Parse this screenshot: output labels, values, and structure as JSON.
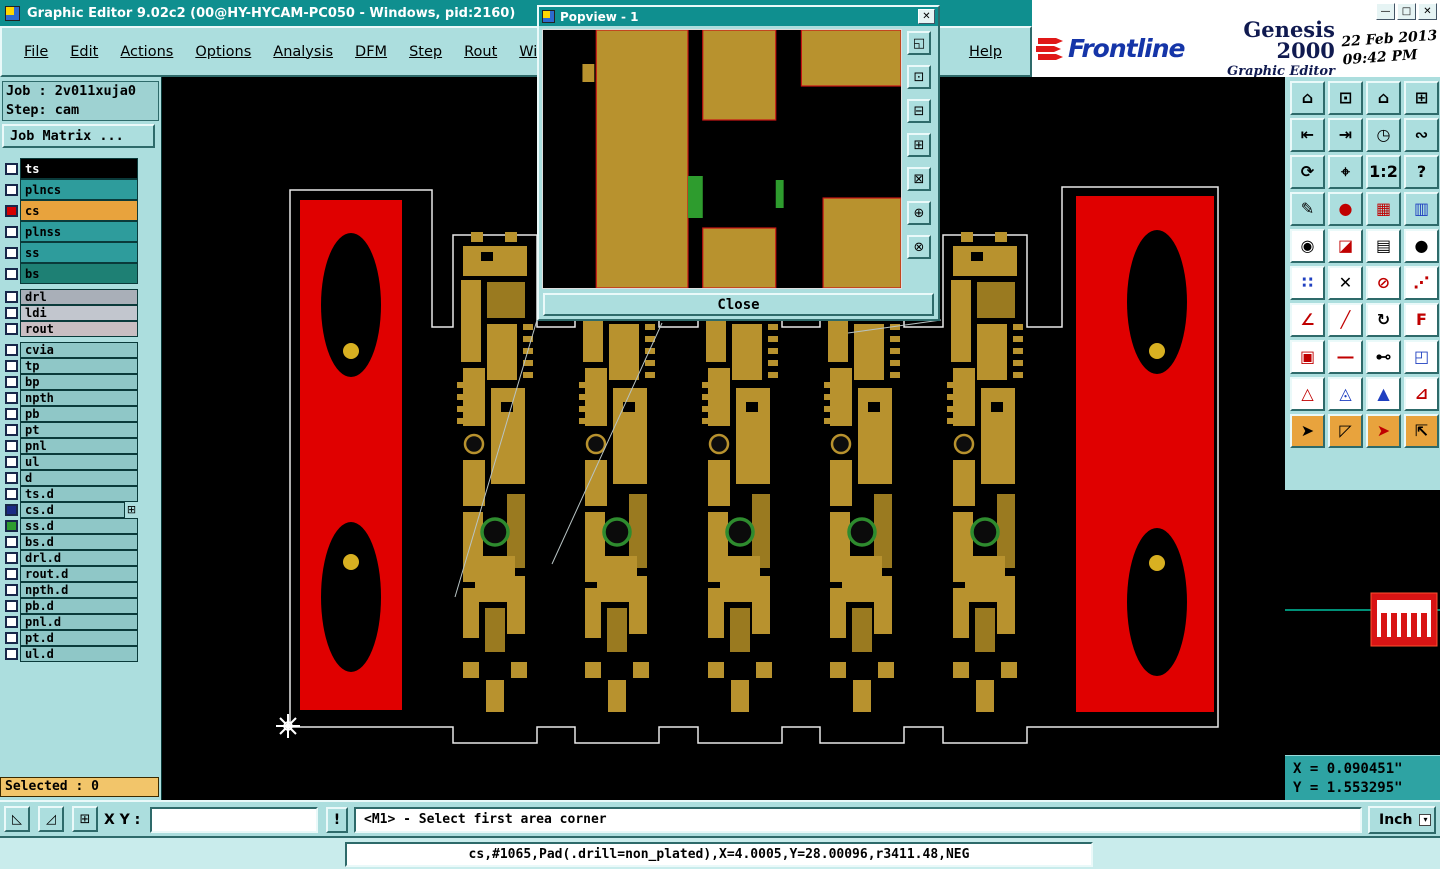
{
  "window": {
    "title": "Graphic Editor 9.02c2 (00@HY-HYCAM-PC050 - Windows, pid:2160)",
    "minimize": "—",
    "maximize": "□",
    "close": "✕"
  },
  "menu": {
    "items": [
      "File",
      "Edit",
      "Actions",
      "Options",
      "Analysis",
      "DFM",
      "Step",
      "Rout",
      "Windows"
    ],
    "help": "Help"
  },
  "brand": {
    "name": "Frontline",
    "product": "Genesis 2000",
    "subtitle": "Graphic Editor",
    "date": "22 Feb 2013",
    "time": "09:42 PM"
  },
  "job_panel": {
    "job": "Job : 2v011xuja0",
    "step": "Step: cam",
    "matrix_button": "Job Matrix ...",
    "selected": "Selected : 0"
  },
  "layers": [
    {
      "name": "ts",
      "color": "#000000",
      "text": "#FFFFFF",
      "check": "#FFFFFF"
    },
    {
      "name": "plncs",
      "color": "#2E9C9C",
      "text": "#000000",
      "check": "#FFFFFF"
    },
    {
      "name": "cs",
      "color": "#E8A33D",
      "text": "#000000",
      "check": "#D40000"
    },
    {
      "name": "plnss",
      "color": "#2E9C9C",
      "text": "#000000",
      "check": "#FFFFFF"
    },
    {
      "name": "ss",
      "color": "#2E9C9C",
      "text": "#000000",
      "check": "#FFFFFF"
    },
    {
      "name": "bs",
      "color": "#1E8074",
      "text": "#000000",
      "check": "#FFFFFF"
    },
    {
      "name": "drl",
      "color": "#A9AFB8",
      "text": "#000000",
      "check": "#FFFFFF"
    },
    {
      "name": "ldi",
      "color": "#C2C6CE",
      "text": "#000000",
      "check": "#FFFFFF"
    },
    {
      "name": "rout",
      "color": "#C9BEC2",
      "text": "#000000",
      "check": "#FFFFFF"
    },
    {
      "name": "cvia",
      "color": "#8FC7C7",
      "text": "#000000",
      "check": "#FFFFFF"
    },
    {
      "name": "tp",
      "color": "#8FC7C7",
      "text": "#000000",
      "check": "#FFFFFF"
    },
    {
      "name": "bp",
      "color": "#8FC7C7",
      "text": "#000000",
      "check": "#FFFFFF"
    },
    {
      "name": "npth",
      "color": "#8FC7C7",
      "text": "#000000",
      "check": "#FFFFFF"
    },
    {
      "name": "pb",
      "color": "#8FC7C7",
      "text": "#000000",
      "check": "#FFFFFF"
    },
    {
      "name": "pt",
      "color": "#8FC7C7",
      "text": "#000000",
      "check": "#FFFFFF"
    },
    {
      "name": "pnl",
      "color": "#8FC7C7",
      "text": "#000000",
      "check": "#FFFFFF"
    },
    {
      "name": "ul",
      "color": "#8FC7C7",
      "text": "#000000",
      "check": "#FFFFFF"
    },
    {
      "name": "d",
      "color": "#8FC7C7",
      "text": "#000000",
      "check": "#FFFFFF"
    },
    {
      "name": "ts.d",
      "color": "#8FC7C7",
      "text": "#000000",
      "check": "#FFFFFF"
    },
    {
      "name": "cs.d",
      "color": "#8FC7C7",
      "text": "#000000",
      "check": "#1A2A85",
      "badge": "⊞"
    },
    {
      "name": "ss.d",
      "color": "#8FC7C7",
      "text": "#000000",
      "check": "#2E9C2E"
    },
    {
      "name": "bs.d",
      "color": "#8FC7C7",
      "text": "#000000",
      "check": "#FFFFFF"
    },
    {
      "name": "drl.d",
      "color": "#8FC7C7",
      "text": "#000000",
      "check": "#FFFFFF"
    },
    {
      "name": "rout.d",
      "color": "#8FC7C7",
      "text": "#000000",
      "check": "#FFFFFF"
    },
    {
      "name": "npth.d",
      "color": "#8FC7C7",
      "text": "#000000",
      "check": "#FFFFFF"
    },
    {
      "name": "pb.d",
      "color": "#8FC7C7",
      "text": "#000000",
      "check": "#FFFFFF"
    },
    {
      "name": "pnl.d",
      "color": "#8FC7C7",
      "text": "#000000",
      "check": "#FFFFFF"
    },
    {
      "name": "pt.d",
      "color": "#8FC7C7",
      "text": "#000000",
      "check": "#FFFFFF"
    },
    {
      "name": "ul.d",
      "color": "#8FC7C7",
      "text": "#000000",
      "check": "#FFFFFF"
    }
  ],
  "toolbar": {
    "buttons": [
      {
        "name": "home",
        "g": "⌂",
        "bg": "#ACDEDE",
        "fg": "#000000"
      },
      {
        "name": "monitor",
        "g": "⊡",
        "bg": "#ACDEDE",
        "fg": "#000000"
      },
      {
        "name": "home-alt",
        "g": "⌂",
        "bg": "#ACDEDE",
        "fg": "#000000"
      },
      {
        "name": "tile-windows",
        "g": "⊞",
        "bg": "#ACDEDE",
        "fg": "#000000"
      },
      {
        "name": "dock-left",
        "g": "⇤",
        "bg": "#ACDEDE",
        "fg": "#000000"
      },
      {
        "name": "dock-right",
        "g": "⇥",
        "bg": "#ACDEDE",
        "fg": "#000000"
      },
      {
        "name": "clock",
        "g": "◷",
        "bg": "#ACDEDE",
        "fg": "#000000"
      },
      {
        "name": "snake",
        "g": "∾",
        "bg": "#ACDEDE",
        "fg": "#000000"
      },
      {
        "name": "rotate-view",
        "g": "⟳",
        "bg": "#ACDEDE",
        "fg": "#000000"
      },
      {
        "name": "target",
        "g": "⌖",
        "bg": "#ACDEDE",
        "fg": "#000000"
      },
      {
        "name": "zoom-1-2",
        "g": "1:2",
        "bg": "#ACDEDE",
        "fg": "#000000"
      },
      {
        "name": "help",
        "g": "?",
        "bg": "#ACDEDE",
        "fg": "#000000"
      },
      {
        "name": "pen",
        "g": "✎",
        "bg": "#ACDEDE",
        "fg": "#000000"
      },
      {
        "name": "red-dot",
        "g": "●",
        "bg": "#ACDEDE",
        "fg": "#C00000"
      },
      {
        "name": "grid-red",
        "g": "▦",
        "bg": "#ACDEDE",
        "fg": "#C00000"
      },
      {
        "name": "grid-blue",
        "g": "▥",
        "bg": "#ACDEDE",
        "fg": "#2040C0"
      },
      {
        "name": "pad-dot",
        "g": "◉",
        "bg": "#FFFFFF",
        "fg": "#000000"
      },
      {
        "name": "half-fill",
        "g": "◪",
        "bg": "#FFFFFF",
        "fg": "#C00000"
      },
      {
        "name": "ruler",
        "g": "▤",
        "bg": "#FFFFFF",
        "fg": "#000000"
      },
      {
        "name": "filled-circle",
        "g": "●",
        "bg": "#FFFFFF",
        "fg": "#000000"
      },
      {
        "name": "blue-pads",
        "g": "∷",
        "bg": "#FFFFFF",
        "fg": "#2040C0"
      },
      {
        "name": "delete-x",
        "g": "✕",
        "bg": "#FFFFFF",
        "fg": "#000000"
      },
      {
        "name": "circle-slash",
        "g": "⊘",
        "bg": "#FFFFFF",
        "fg": "#C00000"
      },
      {
        "name": "diag-dots",
        "g": "⋰",
        "bg": "#FFFFFF",
        "fg": "#C00000"
      },
      {
        "name": "angle",
        "g": "∠",
        "bg": "#FFFFFF",
        "fg": "#C00000"
      },
      {
        "name": "slash",
        "g": "╱",
        "bg": "#FFFFFF",
        "fg": "#C00000"
      },
      {
        "name": "rotate-cw",
        "g": "↻",
        "bg": "#FFFFFF",
        "fg": "#000000"
      },
      {
        "name": "mirror-f",
        "g": "Ϝ",
        "bg": "#FFFFFF",
        "fg": "#C00000"
      },
      {
        "name": "red-frame",
        "g": "▣",
        "bg": "#FFFFFF",
        "fg": "#C00000"
      },
      {
        "name": "red-line",
        "g": "―",
        "bg": "#FFFFFF",
        "fg": "#C00000"
      },
      {
        "name": "measure",
        "g": "⊷",
        "bg": "#FFFFFF",
        "fg": "#000000"
      },
      {
        "name": "corner-box",
        "g": "◰",
        "bg": "#FFFFFF",
        "fg": "#2040C0"
      },
      {
        "name": "triangle-outline",
        "g": "△",
        "bg": "#FFFFFF",
        "fg": "#C00000"
      },
      {
        "name": "triangle-dot",
        "g": "◬",
        "bg": "#FFFFFF",
        "fg": "#2040C0"
      },
      {
        "name": "triangle-filled",
        "g": "▲",
        "bg": "#FFFFFF",
        "fg": "#2040C0"
      },
      {
        "name": "triangle-right",
        "g": "⊿",
        "bg": "#FFFFFF",
        "fg": "#C00000"
      },
      {
        "name": "select-arrow",
        "g": "➤",
        "bg": "#E8A33D",
        "fg": "#000000"
      },
      {
        "name": "select-arrow-box",
        "g": "◸",
        "bg": "#E8A33D",
        "fg": "#000000"
      },
      {
        "name": "select-arrow-red",
        "g": "➤",
        "bg": "#E8A33D",
        "fg": "#C00000"
      },
      {
        "name": "select-arrow-grid",
        "g": "⇱",
        "bg": "#E8A33D",
        "fg": "#000000"
      }
    ]
  },
  "popview": {
    "title": "Popview - 1",
    "close_button": "Close",
    "close_icon": "✕",
    "tools": [
      "◱",
      "⊡",
      "⊟",
      "⊞",
      "⊠",
      "⊕",
      "⊗"
    ]
  },
  "coords": {
    "x": "X = 0.090451\"",
    "y": "Y = 1.553295\""
  },
  "bottom": {
    "buttons": [
      "◺",
      "◿",
      "⊞"
    ],
    "xy_label": "X Y :",
    "xy_value": "",
    "bang": "!",
    "prompt": "<M1> - Select first area corner",
    "units": "Inch",
    "units_arrow": "▾"
  },
  "status": "cs,#1065,Pad(.drill=non_plated),X=4.0005,Y=28.00096,r3411.48,NEG"
}
